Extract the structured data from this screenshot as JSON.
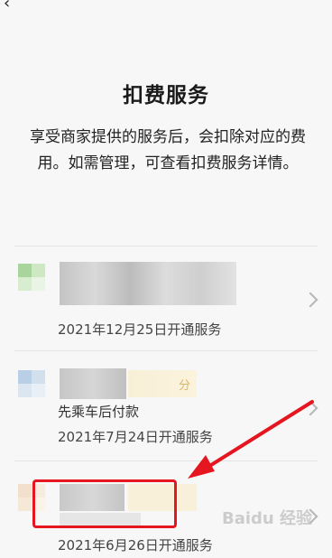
{
  "header": {
    "back_icon": "chevron-left-icon"
  },
  "title": "扣费服务",
  "description": "享受商家提供的服务后，会扣除对应的费用。如需管理，可查看扣费服务详情。",
  "services": [
    {
      "date_text": "2021年12月25日开通服务"
    },
    {
      "badge": "分",
      "subtitle": "先乘车后付款",
      "date_text": "2021年7月24日开通服务"
    },
    {
      "date_text": "2021年6月26日开通服务"
    }
  ],
  "watermark": "Baidu 经验"
}
